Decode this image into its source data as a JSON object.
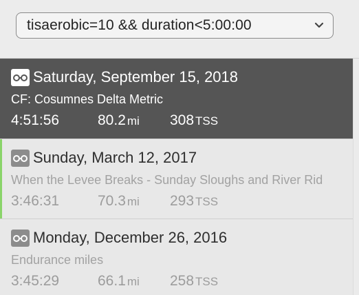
{
  "filter": {
    "value": "tisaerobic=10 && duration<5:00:00",
    "icon": "chevron-down-icon"
  },
  "colors": {
    "selected_bg": "#555555",
    "accent": "#8ad46a"
  },
  "rides": [
    {
      "date": "Saturday, September 15, 2018",
      "title": "CF: Cosumnes Delta Metric",
      "duration": "4:51:56",
      "distance": "80.2",
      "distance_unit": "mi",
      "tss": "308",
      "tss_unit": "TSS",
      "icon": "bike-icon",
      "selected": true
    },
    {
      "date": "Sunday, March 12, 2017",
      "title": "When the Levee Breaks - Sunday Sloughs and River Rid",
      "duration": "3:46:31",
      "distance": "70.3",
      "distance_unit": "mi",
      "tss": "293",
      "tss_unit": "TSS",
      "icon": "bike-icon",
      "accent": true
    },
    {
      "date": "Monday, December 26, 2016",
      "title": "Endurance miles",
      "duration": "3:45:29",
      "distance": "66.1",
      "distance_unit": "mi",
      "tss": "258",
      "tss_unit": "TSS",
      "icon": "bike-icon"
    }
  ]
}
